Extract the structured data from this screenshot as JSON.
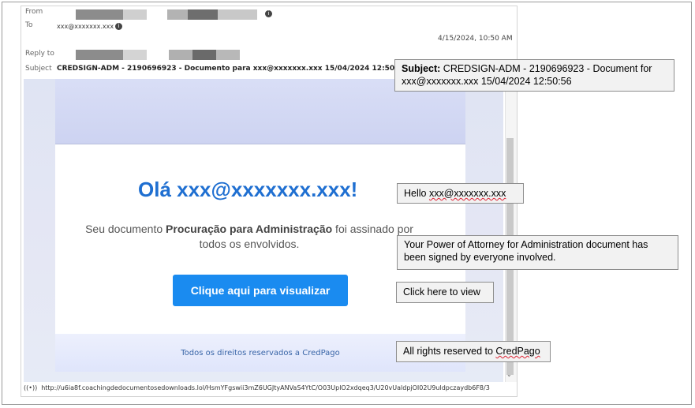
{
  "email_header": {
    "from_label": "From",
    "to_label": "To",
    "to_value": "xxx@xxxxxxx.xxx",
    "reply_to_label": "Reply to",
    "subject_label": "Subject",
    "subject_value": "CREDSIGN-ADM - 2190696923 - Documento para xxx@xxxxxxx.xxx 15/04/2024 12:50:56",
    "date": "4/15/2024, 10:50 AM"
  },
  "email_body": {
    "greeting": "Olá xxx@xxxxxxx.xxx!",
    "desc_prefix": "Seu documento ",
    "desc_doc_name": "Procuração para Administração",
    "desc_suffix": " foi assinado por todos os envolvidos.",
    "cta_label": "Clique aqui para visualizar",
    "footer": "Todos os direitos reservados a CredPago"
  },
  "status_bar": {
    "url": "http://u6ia8f.coachingdedocumentosedownloads.lol/HsmYFgswii3mZ6UGJtyANVaS4YtC/O03UplO2xdqeq3/U20vUaldpjOI02U9uldpczaydb6F8/3"
  },
  "annotations": {
    "subject_bold": "Subject:",
    "subject_text": " CREDSIGN-ADM - 2190696923 - Document for xxx@xxxxxxx.xxx 15/04/2024 12:50:56",
    "hello_prefix": "Hello ",
    "hello_email": "xxx@xxxxxxx.xxx",
    "doc_signed": "Your Power of Attorney for Administration document has been signed by everyone involved.",
    "click_view": "Click here to view",
    "rights_prefix": "All rights reserved to ",
    "rights_brand": "CredPago"
  },
  "icons": {
    "info": "info-circle-icon",
    "wifi": "signal-icon",
    "scroll": "chevron-down-icon"
  },
  "colors": {
    "brand_blue": "#1f6fd1",
    "button_blue": "#1a8bf0"
  }
}
